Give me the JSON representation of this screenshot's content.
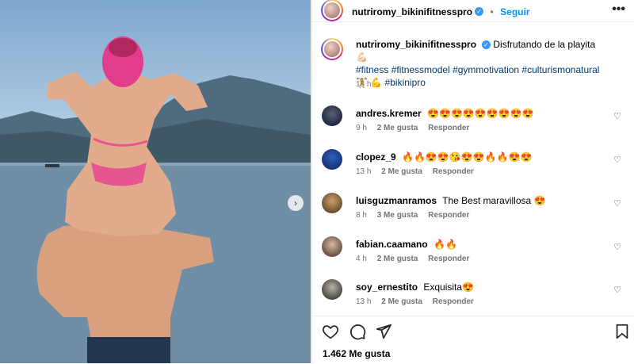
{
  "post": {
    "username": "nutriromy_bikinifitnesspro",
    "follow_label": "Seguir",
    "caption_text": "Disfrutando de la playita 💪🏻",
    "caption_hashtags": "#fitness #fitnessmodel #gymmotivation #culturismonatural 🏋️ 💪 #bikinipro",
    "caption_time": "13 h",
    "likes": "1.462 Me gusta"
  },
  "comments": [
    {
      "user": "andres.kremer",
      "text": "😍😍😍😍😍😍😍😍😍",
      "time": "9 h",
      "likes": "2 Me gusta",
      "reply": "Responder"
    },
    {
      "user": "clopez_9",
      "text": "🔥🔥😍😍😘😍😍🔥🔥😍😍",
      "time": "13 h",
      "likes": "2 Me gusta",
      "reply": "Responder"
    },
    {
      "user": "luisguzmanramos",
      "text": "The Best maravillosa 😍",
      "time": "8 h",
      "likes": "3 Me gusta",
      "reply": "Responder"
    },
    {
      "user": "fabian.caamano",
      "text": "🔥🔥",
      "time": "4 h",
      "likes": "2 Me gusta",
      "reply": "Responder"
    },
    {
      "user": "soy_ernestito",
      "text": "Exquisita😍",
      "time": "13 h",
      "likes": "2 Me gusta",
      "reply": "Responder"
    }
  ],
  "icons": {
    "verified": "✓",
    "more": "•••",
    "heart_small": "♡",
    "next": "›"
  },
  "colors": {
    "link": "#0095f6",
    "hashtag": "#00376b",
    "verified": "#3897f0",
    "meta": "#737373"
  }
}
